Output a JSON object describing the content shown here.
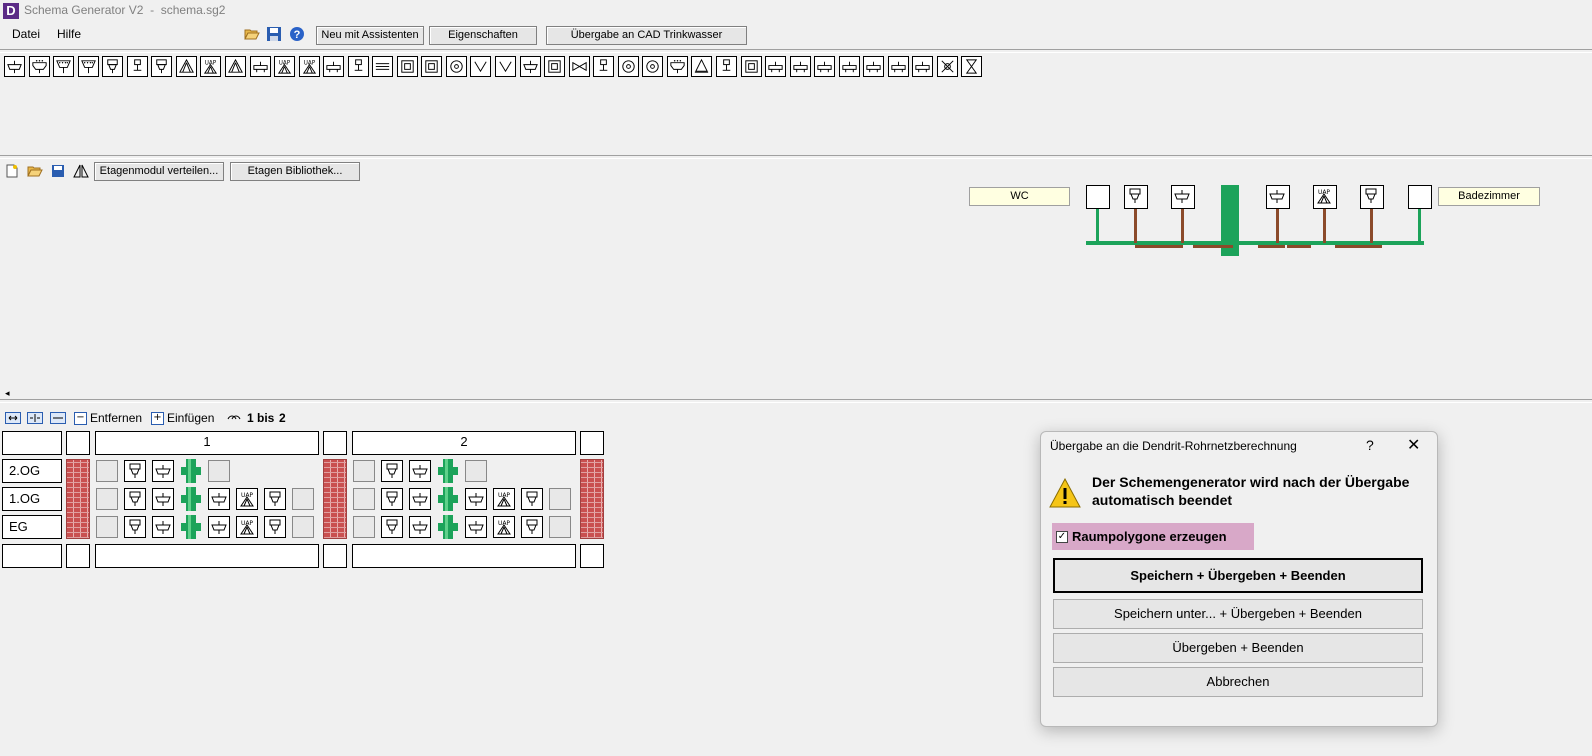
{
  "window": {
    "title": "Schema Generator V2  -  schema.sg2",
    "logo": "D"
  },
  "menu": {
    "items": [
      "Datei",
      "Hilfe"
    ]
  },
  "toolbar": {
    "open_icon": "folder-open-icon",
    "save_icon": "floppy-disk-icon",
    "help_icon": "help-icon",
    "btn_assistant": "Neu mit Assistenten",
    "btn_properties": "Eigenschaften",
    "btn_cad": "Übergabe an CAD Trinkwasser"
  },
  "floor_toolbar": {
    "btn_distribute": "Etagenmodul verteilen...",
    "btn_library": "Etagen Bibliothek..."
  },
  "module": {
    "left_label": "WC",
    "right_label": "Badezimmer"
  },
  "grid_toolbar": {
    "remove": "Entfernen",
    "insert": "Einfügen",
    "range_prefix": "1 bis",
    "range_end": "2"
  },
  "grid": {
    "columns": [
      "1",
      "2"
    ],
    "floors": [
      "2.OG",
      "1.OG",
      "EG"
    ]
  },
  "dialog": {
    "title": "Übergabe an die Dendrit-Rohrnetzberechnung",
    "help": "?",
    "close": "✕",
    "message": "Der Schemengenerator wird nach der Übergabe automatisch beendet",
    "checkbox_label": "Raumpolygone erzeugen",
    "checkbox_checked": true,
    "buttons": {
      "save_transfer": "Speichern + Übergeben + Beenden",
      "save_as_transfer": "Speichern unter... + Übergeben + Beenden",
      "transfer": "Übergeben + Beenden",
      "cancel": "Abbrechen"
    }
  },
  "colors": {
    "pipe": "#1ca35a",
    "wall": "#c95050",
    "label_bg": "#ffffe1",
    "highlight": "#d8a8c8"
  }
}
